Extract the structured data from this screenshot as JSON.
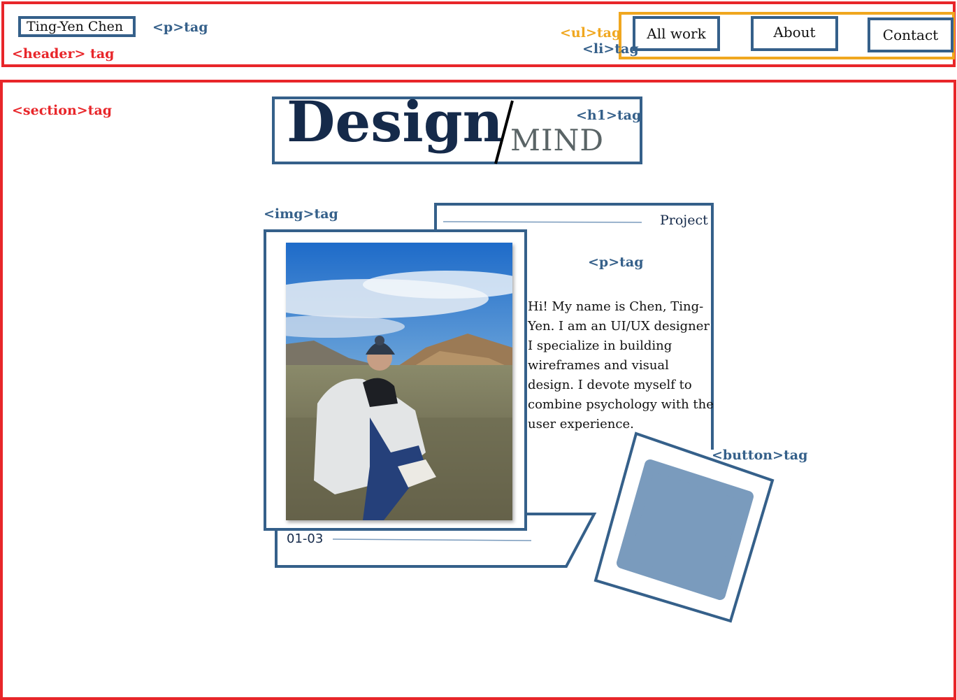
{
  "header": {
    "brand": "Ting-Yen Chen",
    "tag_header": "<header> tag",
    "tag_p": "<p>tag",
    "tag_ul": "<ul>tag",
    "tag_li": "<li>tag",
    "nav": {
      "all_work": "All work",
      "about": "About",
      "contact": "Contact"
    }
  },
  "section": {
    "tag_section": "<section>tag",
    "tag_h1": "<h1>tag",
    "title_main": "Design",
    "title_sub": "MIND",
    "tag_img": "<img>tag",
    "photo_alt": "Photo of a woman in a white fleece jacket and beanie sitting in a high desert landscape",
    "project_label": "Project",
    "tag_p2": "<p>tag",
    "bio": "Hi! My name is Chen, Ting-Yen. I am an UI/UX designer I specialize in building wireframes and visual design. I devote myself to combine psychology with the user experience.",
    "counter": "01-03",
    "tag_button": "<button>tag"
  },
  "colors": {
    "header_red": "#e8262a",
    "frame_blue": "#35608a",
    "nav_orange": "#f0a71f",
    "button_fill": "#7a9bbd",
    "title_navy": "#152a4a",
    "title_gray": "#5a6466"
  }
}
